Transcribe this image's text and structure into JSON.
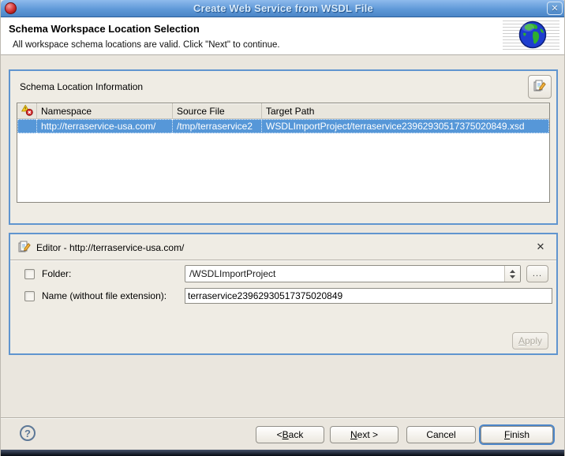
{
  "titlebar": {
    "title": "Create Web Service from WSDL File"
  },
  "banner": {
    "title": "Schema Workspace Location Selection",
    "description": "All workspace schema locations are valid. Click \"Next\" to continue."
  },
  "schema_panel": {
    "title": "Schema Location Information",
    "table": {
      "columns": [
        "Namespace",
        "Source File",
        "Target Path"
      ],
      "row": {
        "namespace": "http://terraservice-usa.com/",
        "source_file": "/tmp/terraservice2",
        "target_path": "WSDLImportProject/terraservice23962930517375020849.xsd"
      }
    }
  },
  "editor": {
    "title": "Editor - http://terraservice-usa.com/",
    "close_glyph": "✕",
    "folder": {
      "label": "Folder:",
      "value": "/WSDLImportProject"
    },
    "name": {
      "label": "Name (without file extension):",
      "value": "terraservice23962930517375020849"
    },
    "browse_label": "...",
    "apply_label": "&Apply"
  },
  "footer": {
    "help_glyph": "?",
    "back_label": "< &Back",
    "next_label": "&Next >",
    "cancel_label": "Cancel",
    "finish_label": "&Finish"
  },
  "colors": {
    "selection_blue": "#5697d8",
    "panel_border_blue": "#6095cf",
    "titlebar_top": "#8fbaec",
    "titlebar_bottom": "#4a85c6",
    "dialog_background": "#eae6de"
  }
}
